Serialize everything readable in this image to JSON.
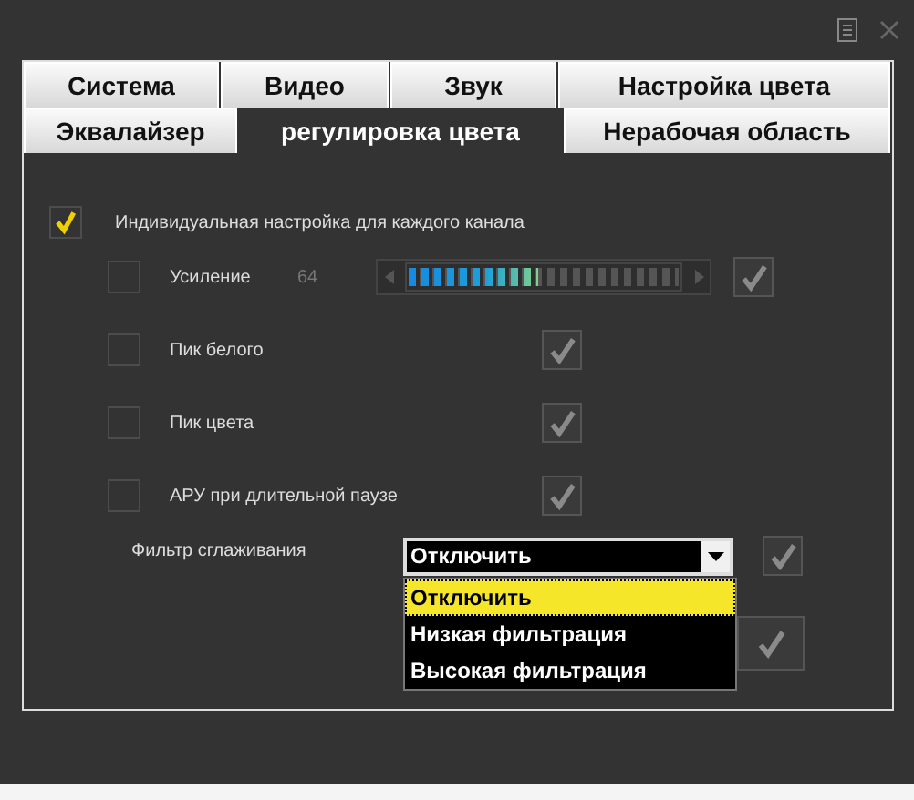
{
  "tab_rows": [
    {
      "tabs": [
        {
          "label": "Система",
          "selected": false
        },
        {
          "label": "Видео",
          "selected": false
        },
        {
          "label": "Звук",
          "selected": false
        },
        {
          "label": "Настройка цвета",
          "selected": false
        }
      ]
    },
    {
      "tabs": [
        {
          "label": "Эквалайзер",
          "selected": false
        },
        {
          "label": "регулировка цвета",
          "selected": true
        },
        {
          "label": "Нерабочая область",
          "selected": false
        }
      ]
    }
  ],
  "individual": {
    "label": "Индивидуальная настройка для каждого канала",
    "checked": true
  },
  "settings": [
    {
      "kind": "slider",
      "label": "Усиление",
      "checked": false,
      "value": "64",
      "level": 0.48
    },
    {
      "kind": "toggle",
      "label": "Пик белого",
      "checked": false
    },
    {
      "kind": "toggle",
      "label": "Пик цвета",
      "checked": false
    },
    {
      "kind": "toggle",
      "label": "АРУ при длительной паузе",
      "checked": false
    }
  ],
  "filter": {
    "label": "Фильтр сглаживания",
    "value": "Отключить",
    "options": [
      {
        "label": "Отключить",
        "selected": true
      },
      {
        "label": "Низкая фильтрация",
        "selected": false
      },
      {
        "label": "Высокая фильтрация",
        "selected": false
      }
    ]
  }
}
